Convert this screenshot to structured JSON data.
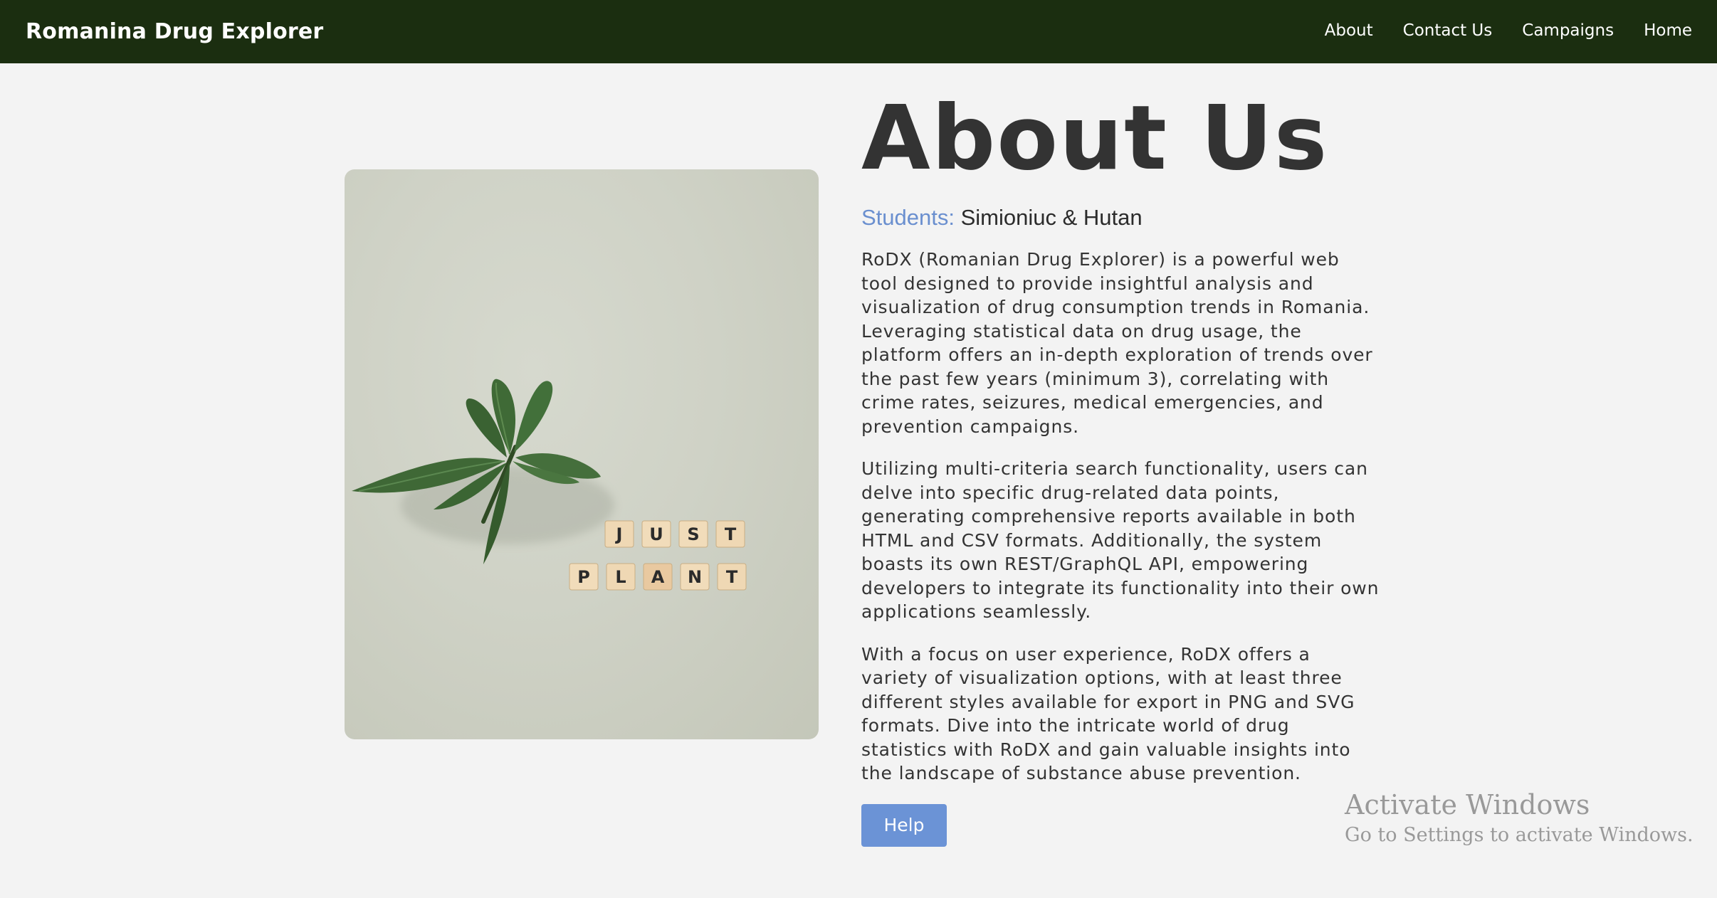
{
  "navbar": {
    "brand": "Romanina Drug Explorer",
    "links": [
      {
        "label": "About"
      },
      {
        "label": "Contact Us"
      },
      {
        "label": "Campaigns"
      },
      {
        "label": "Home"
      }
    ],
    "background": "#1b2e10"
  },
  "hero_image": {
    "icon": "cannabis-leaf-icon",
    "tiles_row1": [
      "J",
      "U",
      "S",
      "T"
    ],
    "tiles_row2": [
      "P",
      "L",
      "A",
      "N",
      "T"
    ]
  },
  "main": {
    "title": "About Us",
    "students_label": "Students:",
    "students_names": "Simioniuc & Hutan",
    "paragraphs": [
      "RoDX (Romanian Drug Explorer) is a powerful web tool designed to provide insightful analysis and visualization of drug consumption trends in Romania. Leveraging statistical data on drug usage, the platform offers an in-depth exploration of trends over the past few years (minimum 3), correlating with crime rates, seizures, medical emergencies, and prevention campaigns.",
      "Utilizing multi-criteria search functionality, users can delve into specific drug-related data points, generating comprehensive reports available in both HTML and CSV formats. Additionally, the system boasts its own REST/GraphQL API, empowering developers to integrate its functionality into their own applications seamlessly.",
      "With a focus on user experience, RoDX offers a variety of visualization options, with at least three different styles available for export in PNG and SVG formats. Dive into the intricate world of drug statistics with RoDX and gain valuable insights into the landscape of substance abuse prevention."
    ],
    "help_label": "Help",
    "accent_color": "#6b93d6"
  },
  "watermark": {
    "title": "Activate Windows",
    "subtitle": "Go to Settings to activate Windows."
  }
}
